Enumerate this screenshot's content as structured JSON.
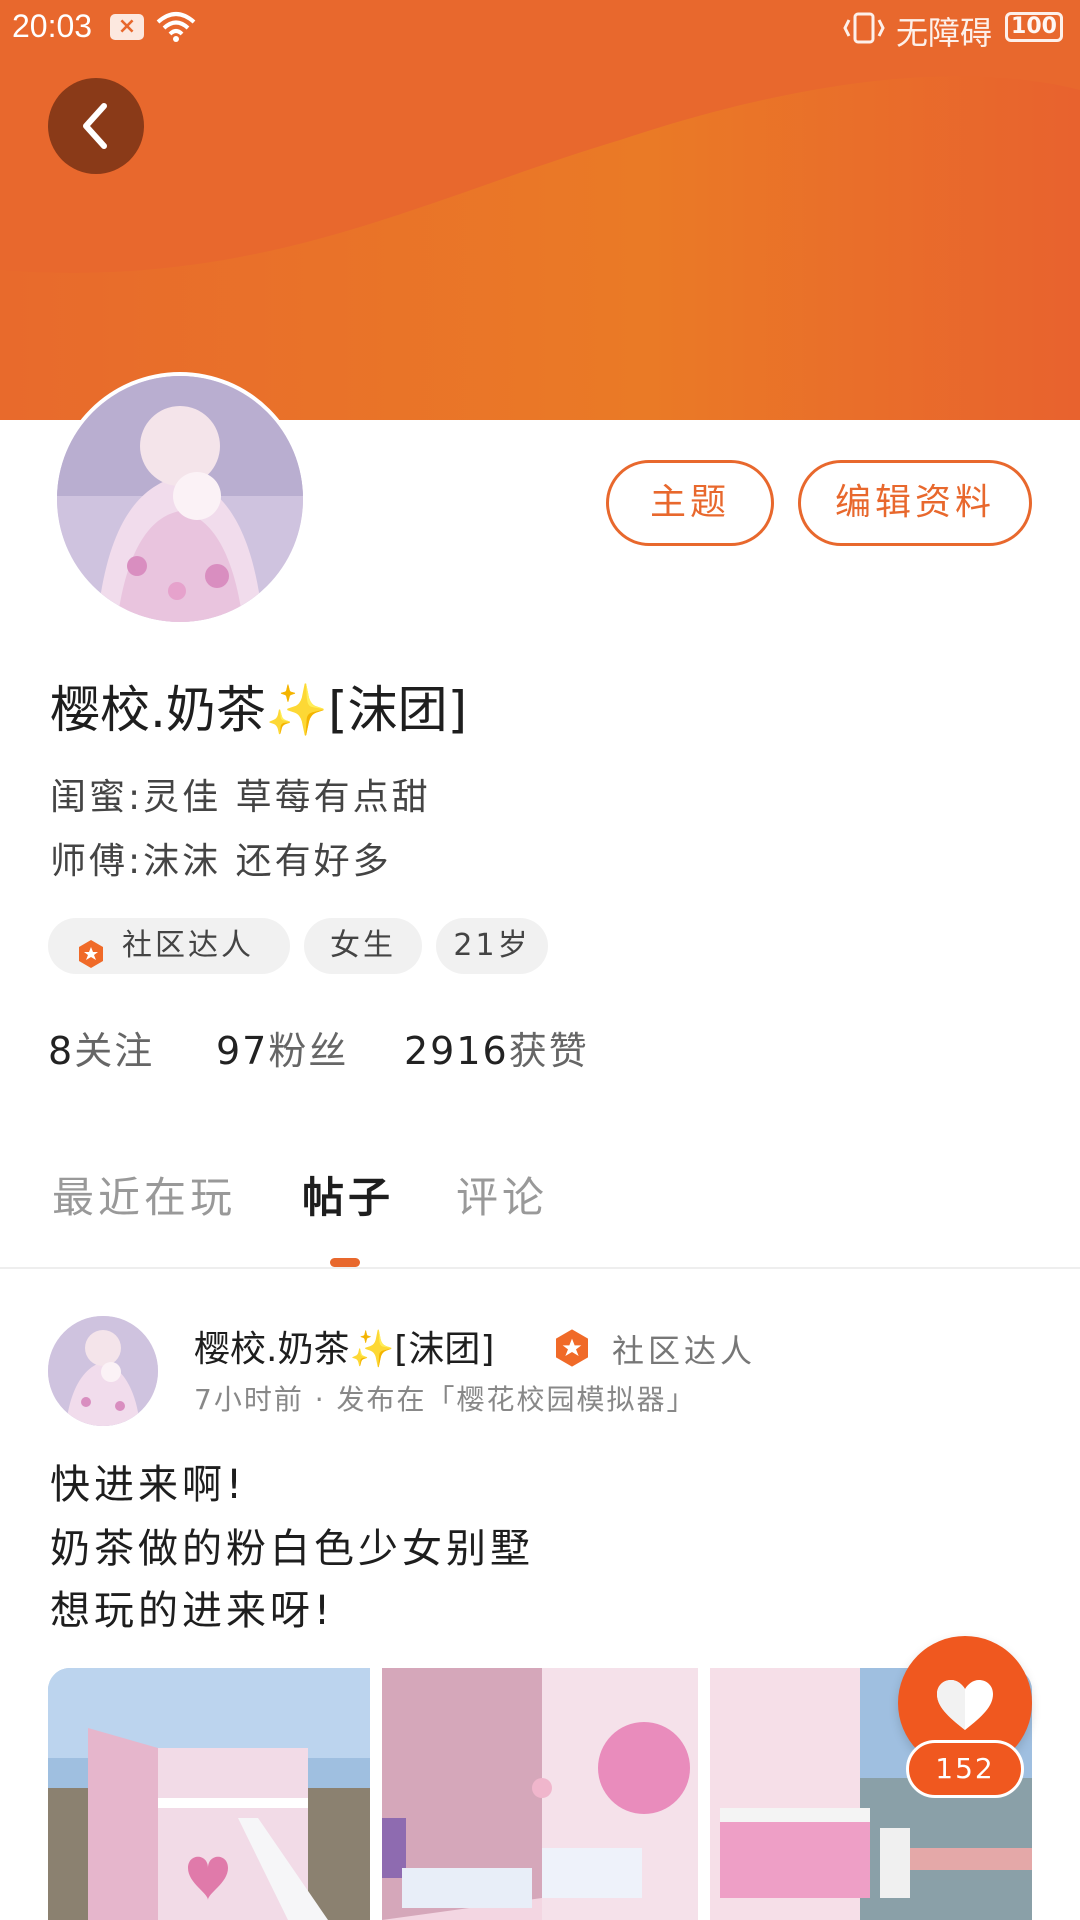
{
  "status_bar": {
    "time": "20:03",
    "accessibility_label": "无障碍",
    "battery": "100"
  },
  "profile": {
    "theme_button": "主题",
    "edit_button": "编辑资料",
    "username": "樱校.奶茶",
    "username_suffix": "[沫团]",
    "bio_line_1": "闺蜜:灵佳 草莓有点甜",
    "bio_line_2": "师傅:沫沫 还有好多",
    "tags": {
      "expert": "社区达人",
      "gender": "女生",
      "age": "21岁"
    },
    "stats": {
      "following_count": "8",
      "following_label": "关注",
      "fans_count": "97",
      "fans_label": "粉丝",
      "likes_count": "2916",
      "likes_label": "获赞"
    }
  },
  "tabs": {
    "recent": "最近在玩",
    "posts": "帖子",
    "comments": "评论",
    "active": "posts"
  },
  "post": {
    "author": "樱校.奶茶",
    "author_suffix": "[沫团]",
    "badge_label": "社区达人",
    "meta": "7小时前 · 发布在「樱花校园模拟器」",
    "line_1": "快进来啊!",
    "line_2": "奶茶做的粉白色少女别墅",
    "line_3": "想玩的进来呀!",
    "like_count": "152"
  },
  "colors": {
    "accent": "#e8682d",
    "like": "#f0581f"
  }
}
